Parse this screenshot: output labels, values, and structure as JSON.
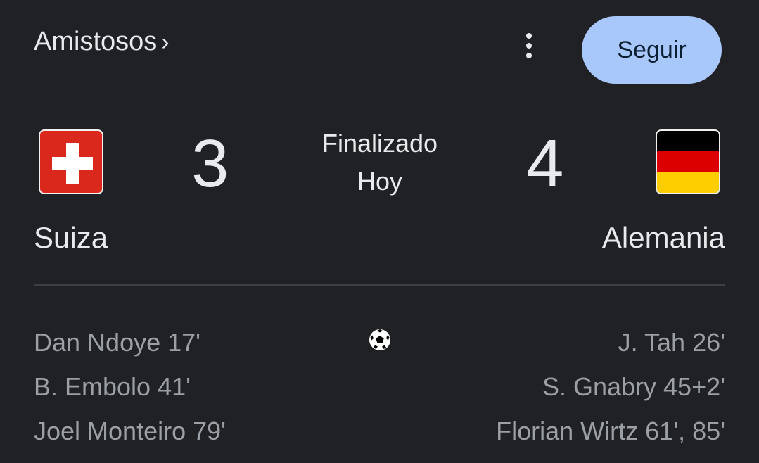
{
  "header": {
    "competition_label": "Amistosos",
    "chevron": "›",
    "follow_label": "Seguir"
  },
  "match": {
    "status": "Finalizado",
    "date": "Hoy",
    "home": {
      "name": "Suiza",
      "score": "3",
      "flag": "switzerland-flag",
      "scorers": [
        "Dan Ndoye 17'",
        "B. Embolo 41'",
        "Joel Monteiro 79'"
      ]
    },
    "away": {
      "name": "Alemania",
      "score": "4",
      "flag": "germany-flag",
      "scorers": [
        "J. Tah 26'",
        "S. Gnabry 45+2'",
        "Florian Wirtz 61', 85'"
      ]
    }
  },
  "icons": {
    "more": "more-vert-icon",
    "goal": "soccer-ball-icon"
  },
  "colors": {
    "background": "#202124",
    "follow_button": "#a8c7fa",
    "text_primary": "#e8eaed",
    "text_secondary": "#9aa0a6",
    "swiss_red": "#da291c",
    "german_black": "#000000",
    "german_red": "#dd0000",
    "german_gold": "#ffce00"
  }
}
